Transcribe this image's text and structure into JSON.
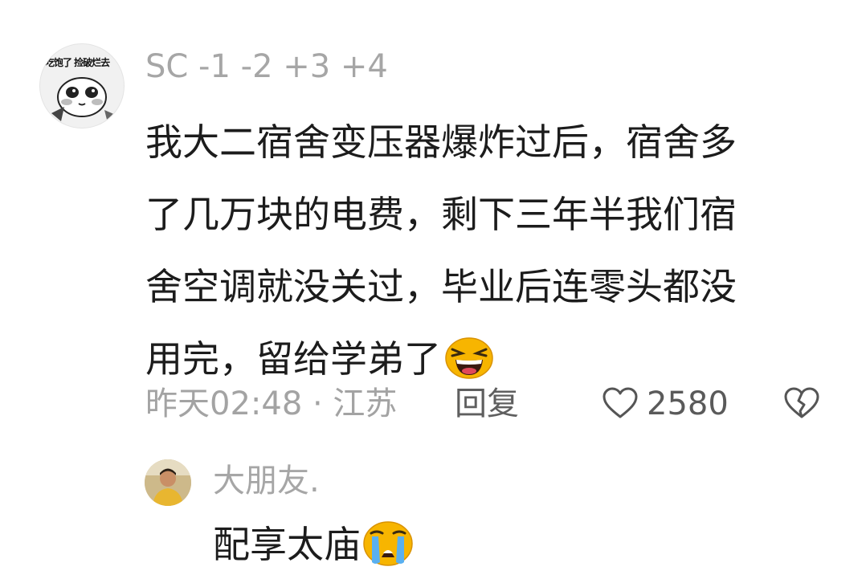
{
  "comment": {
    "username": "SC -1 -2 +3 +4",
    "avatar_sticker_text": "吃饱了 捡破烂去",
    "lines": [
      "我大二宿舍变压器爆炸过后，宿舍多",
      "了几万块的电费，剩下三年半我们宿",
      "舍空调就没关过，毕业后连零头都没",
      "用完，留给学弟了"
    ],
    "emoji": "laughing-face-icon",
    "time_location": "昨天02:48 · 江苏",
    "reply_label": "回复",
    "like_count": "2580",
    "like_icon": "heart-outline-icon",
    "dislike_icon": "broken-heart-icon"
  },
  "reply": {
    "username": "大朋友.",
    "text": "配享太庙",
    "emoji": "crying-face-icon"
  },
  "colors": {
    "username": "#a6a6a6",
    "body_text": "#1c1c1c",
    "meta": "#a3a3a3",
    "emoji_yellow": "#f7b500"
  }
}
